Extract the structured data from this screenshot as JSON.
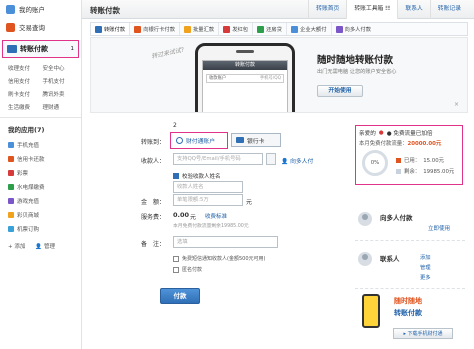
{
  "sidebar": {
    "my_account": "我的账户",
    "transaction_query": "交易查询",
    "transfer": "转账付款",
    "transfer_marker": "1",
    "sub_items": [
      "收理支付",
      "安全中心",
      "信用支付",
      "手机支付",
      "刷卡支付",
      "腾讯外卖",
      "生活缴费",
      "理财通"
    ],
    "my_apps_heading": "我的应用(7)",
    "apps": [
      {
        "label": "手机充值",
        "color": "#4a8fd8"
      },
      {
        "label": "信用卡还款",
        "color": "#e0541f"
      },
      {
        "label": "彩票",
        "color": "#d73a3a"
      },
      {
        "label": "水电煤缴费",
        "color": "#2e9e4a"
      },
      {
        "label": "游戏充值",
        "color": "#7a56c8"
      },
      {
        "label": "彩贝商城",
        "color": "#f0a21c"
      },
      {
        "label": "机票订购",
        "color": "#3aa1d8"
      }
    ],
    "add_label": "添加",
    "manage_label": "管理"
  },
  "topnav": {
    "title": "转账付款",
    "links": [
      "转账首页",
      "转账工具箱 ☷",
      "联系人",
      "转账记录"
    ]
  },
  "toolrow": [
    {
      "label": "转账付款",
      "color": "#2f6fb6",
      "active": true
    },
    {
      "label": "向银行卡付款",
      "color": "#e0541f"
    },
    {
      "label": "批量汇款",
      "color": "#f0a21c"
    },
    {
      "label": "发红包",
      "color": "#d73a3a"
    },
    {
      "label": "还房贷",
      "color": "#2e9e4a"
    },
    {
      "label": "企业大额付",
      "color": "#4a8fd8"
    },
    {
      "label": "向多人付款",
      "color": "#7a56c8"
    }
  ],
  "banner": {
    "hand_text": "转过来试试?",
    "phone_title": "转账付款",
    "phone_field_label": "收款账户",
    "phone_field_hint": "手机号/QQ",
    "title": "随时随地转账付款",
    "subtitle": "出门无需电脑 让您的账户安全省心",
    "button": "开始使用",
    "close": "×"
  },
  "form": {
    "transfer_to_label": "转账到：",
    "tab_marker": "2",
    "tab_caifutong": "财付通账户",
    "tab_bank": "银行卡",
    "payee_label": "收款人：",
    "payee_placeholder": "支持QQ号/Email/手机号码",
    "to_multiple": "向多人付",
    "verify_name_label": "校验收款人姓名",
    "name_placeholder": "收款人姓名",
    "amount_label": "金　额：",
    "amount_placeholder": "单笔限额:5万",
    "amount_unit": "元",
    "fee_label": "服务费：",
    "fee_value": "0.00",
    "fee_unit": "元",
    "fee_link": "收费标准",
    "fee_note": "本月免费付款流量剩余19985.00元",
    "remark_label": "备　注：",
    "remark_placeholder": "选填",
    "opt_notify": "免费短信通知收款人(金额500元可用)",
    "opt_anonymous": "匿名付款",
    "submit": "付款"
  },
  "quota": {
    "greeting": "亲爱的",
    "free_quota_text": "● 免费流量已加倍",
    "month_label": "本月免费付款流量：",
    "month_value": "20000.00元",
    "percent": "0%",
    "used_label": "已用：",
    "used_value": "15.00元",
    "left_label": "剩余：",
    "left_value": "19985.00元",
    "used_color": "#e0541f",
    "left_color": "#c8d2dc"
  },
  "multi_pay": {
    "title": "向多人付款",
    "link": "立即使用"
  },
  "contacts": {
    "title": "联系人",
    "link1": "添加",
    "link2": "管理",
    "link3": "更多"
  },
  "promo": {
    "title": "随时随地",
    "highlight": "转账付款",
    "download": "下载手机财付通"
  }
}
